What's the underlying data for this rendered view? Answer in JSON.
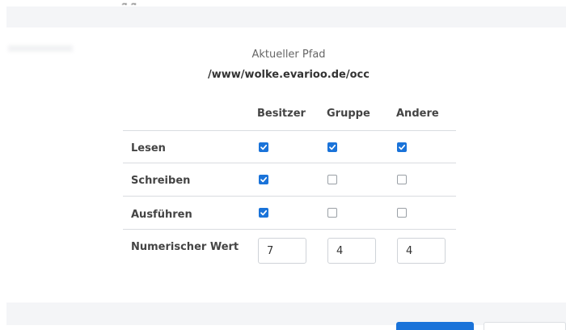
{
  "header": {
    "partial_title": "g  g"
  },
  "path": {
    "label": "Aktueller Pfad",
    "value": "/www/wolke.evarioo.de/occ"
  },
  "columns": [
    "Besitzer",
    "Gruppe",
    "Andere"
  ],
  "rows": [
    {
      "label": "Lesen",
      "owner": true,
      "group": true,
      "other": true
    },
    {
      "label": "Schreiben",
      "owner": true,
      "group": false,
      "other": false
    },
    {
      "label": "Ausführen",
      "owner": true,
      "group": false,
      "other": false
    }
  ],
  "numeric": {
    "label": "Numerischer Wert",
    "owner": "7",
    "group": "4",
    "other": "4"
  },
  "colors": {
    "accent": "#1a73d9",
    "footer_bg": "#f4f5f7"
  }
}
